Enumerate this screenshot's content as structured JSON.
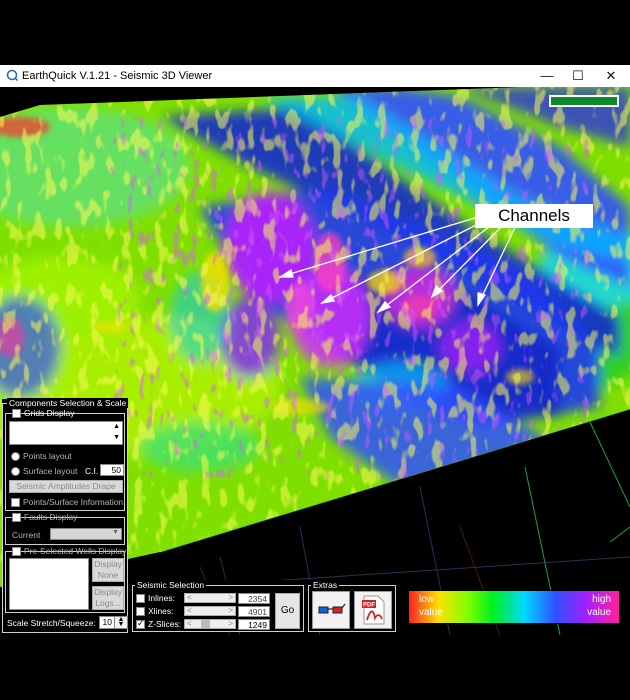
{
  "window": {
    "title": "EarthQuick V.1.21 - Seismic 3D Viewer",
    "minimize": "—",
    "maximize": "☐",
    "close": "✕"
  },
  "annotation": {
    "channels_label": "Channels"
  },
  "components_panel": {
    "title": "Components Selection & Scale",
    "grids_display": "Grids Display",
    "points_layout": "Points layout",
    "surface_layout": "Surface layout",
    "ci_label": "C.I.",
    "ci_value": "50",
    "drape_button": "Seismic Amplitudes Drape",
    "points_surface_info": "Points/Surface Information",
    "faults_display": "Faults Display",
    "current_label": "Current",
    "wells_display": "Pre-Selected Wells Display",
    "display_none": [
      "Display",
      "None"
    ],
    "display_logs": [
      "Display",
      "Logs..."
    ],
    "scale_label": "Scale Stretch/Squeeze:",
    "scale_value": "10"
  },
  "seismic_selection": {
    "title": "Seismic Selection",
    "inlines_label": "Inlines:",
    "inlines_value": "2354",
    "xlines_label": "Xlines:",
    "xlines_value": "4901",
    "zslices_label": "Z-Slices:",
    "zslices_value": "1249",
    "go_button": "Go",
    "zslices_checked": true
  },
  "extras": {
    "title": "Extras",
    "icon_3d": "3d-glasses-icon",
    "icon_pdf": "pdf-icon"
  },
  "legend": {
    "low": [
      "low",
      "value"
    ],
    "high": [
      "high",
      "value"
    ]
  },
  "colors": {
    "accent_green": "#0a8a2a",
    "grid_line": "#20c040"
  }
}
